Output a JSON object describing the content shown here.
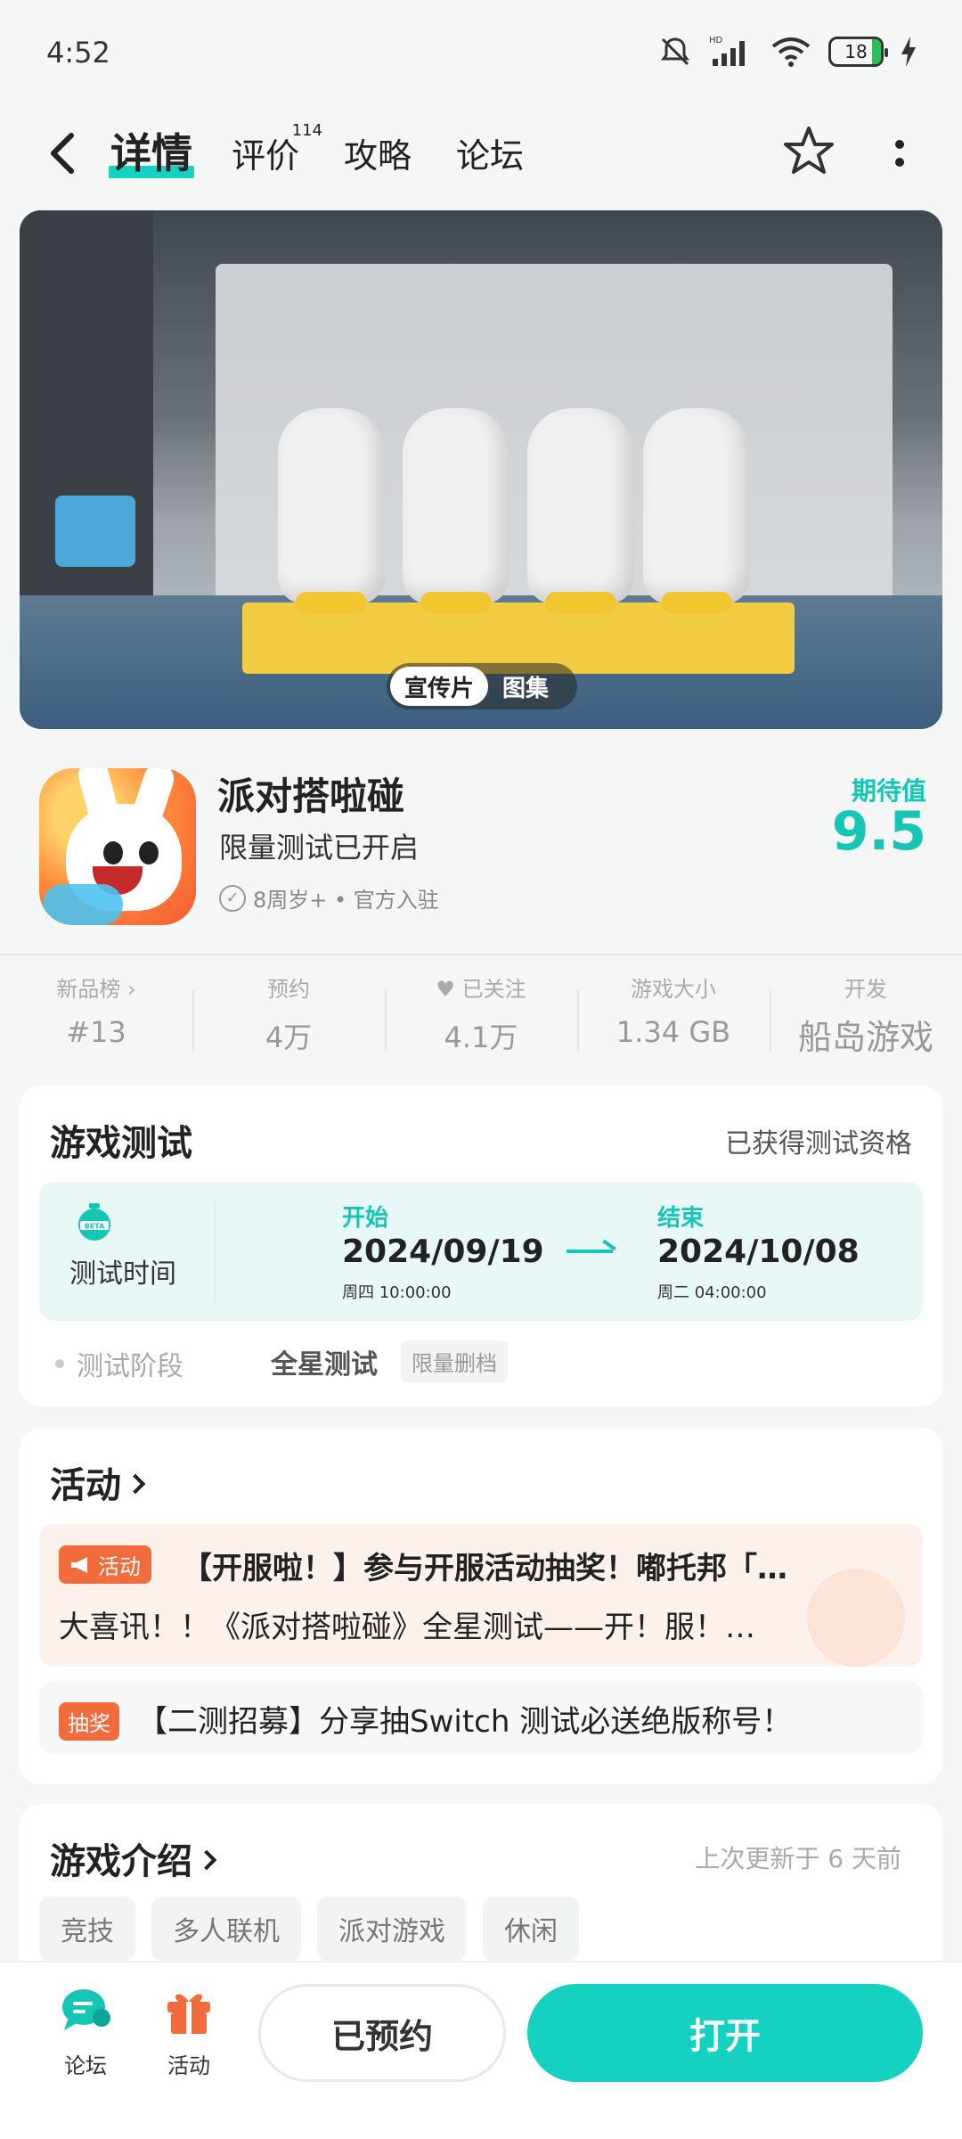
{
  "status_bar": {
    "time": "4:52",
    "battery": "18"
  },
  "nav": {
    "tabs": [
      {
        "label": "详情"
      },
      {
        "label": "评价",
        "badge": "114"
      },
      {
        "label": "攻略"
      },
      {
        "label": "论坛"
      }
    ]
  },
  "hero": {
    "segments": [
      "宣传片",
      "图集"
    ]
  },
  "app": {
    "name": "派对搭啦碰",
    "subtitle": "限量测试已开启",
    "meta": "8周岁+ • 官方入驻",
    "expect_label": "期待值",
    "expect_value": "9.5"
  },
  "stats": [
    {
      "label": "新品榜 ›",
      "value": "#13"
    },
    {
      "label": "预约",
      "value": "4万"
    },
    {
      "label": "♥ 已关注",
      "value": "4.1万"
    },
    {
      "label": "游戏大小",
      "value": "1.34 GB"
    },
    {
      "label": "开发",
      "value": "船岛游戏"
    }
  ],
  "test": {
    "title": "游戏测试",
    "qualification": "已获得测试资格",
    "beta_badge": "BETA",
    "time_label": "测试时间",
    "start_label": "开始",
    "start_date": "2024/09/19",
    "start_sub": "周四  10:00:00",
    "end_label": "结束",
    "end_date": "2024/10/08",
    "end_sub": "周二  04:00:00",
    "phase_label": "测试阶段",
    "phase_value": "全星测试",
    "phase_tag": "限量删档"
  },
  "activity": {
    "title": "活动",
    "item1_tag": "活动",
    "item1_line1": "【开服啦！】参与开服活动抽奖！嘟托邦「…",
    "item1_line2": "大喜讯！！《派对搭啦碰》全星测试——开！服！…",
    "item2_tag": "抽奖",
    "item2_text": "【二测招募】分享抽Switch 测试必送绝版称号！"
  },
  "intro": {
    "title": "游戏介绍",
    "updated": "上次更新于 6 天前",
    "tags": [
      "竞技",
      "多人联机",
      "派对游戏",
      "休闲"
    ]
  },
  "bottom": {
    "forum": "论坛",
    "activity": "活动",
    "reserved": "已预约",
    "open": "打开"
  },
  "colors": {
    "accent": "#14d2bf",
    "orange": "#f26b3c"
  }
}
